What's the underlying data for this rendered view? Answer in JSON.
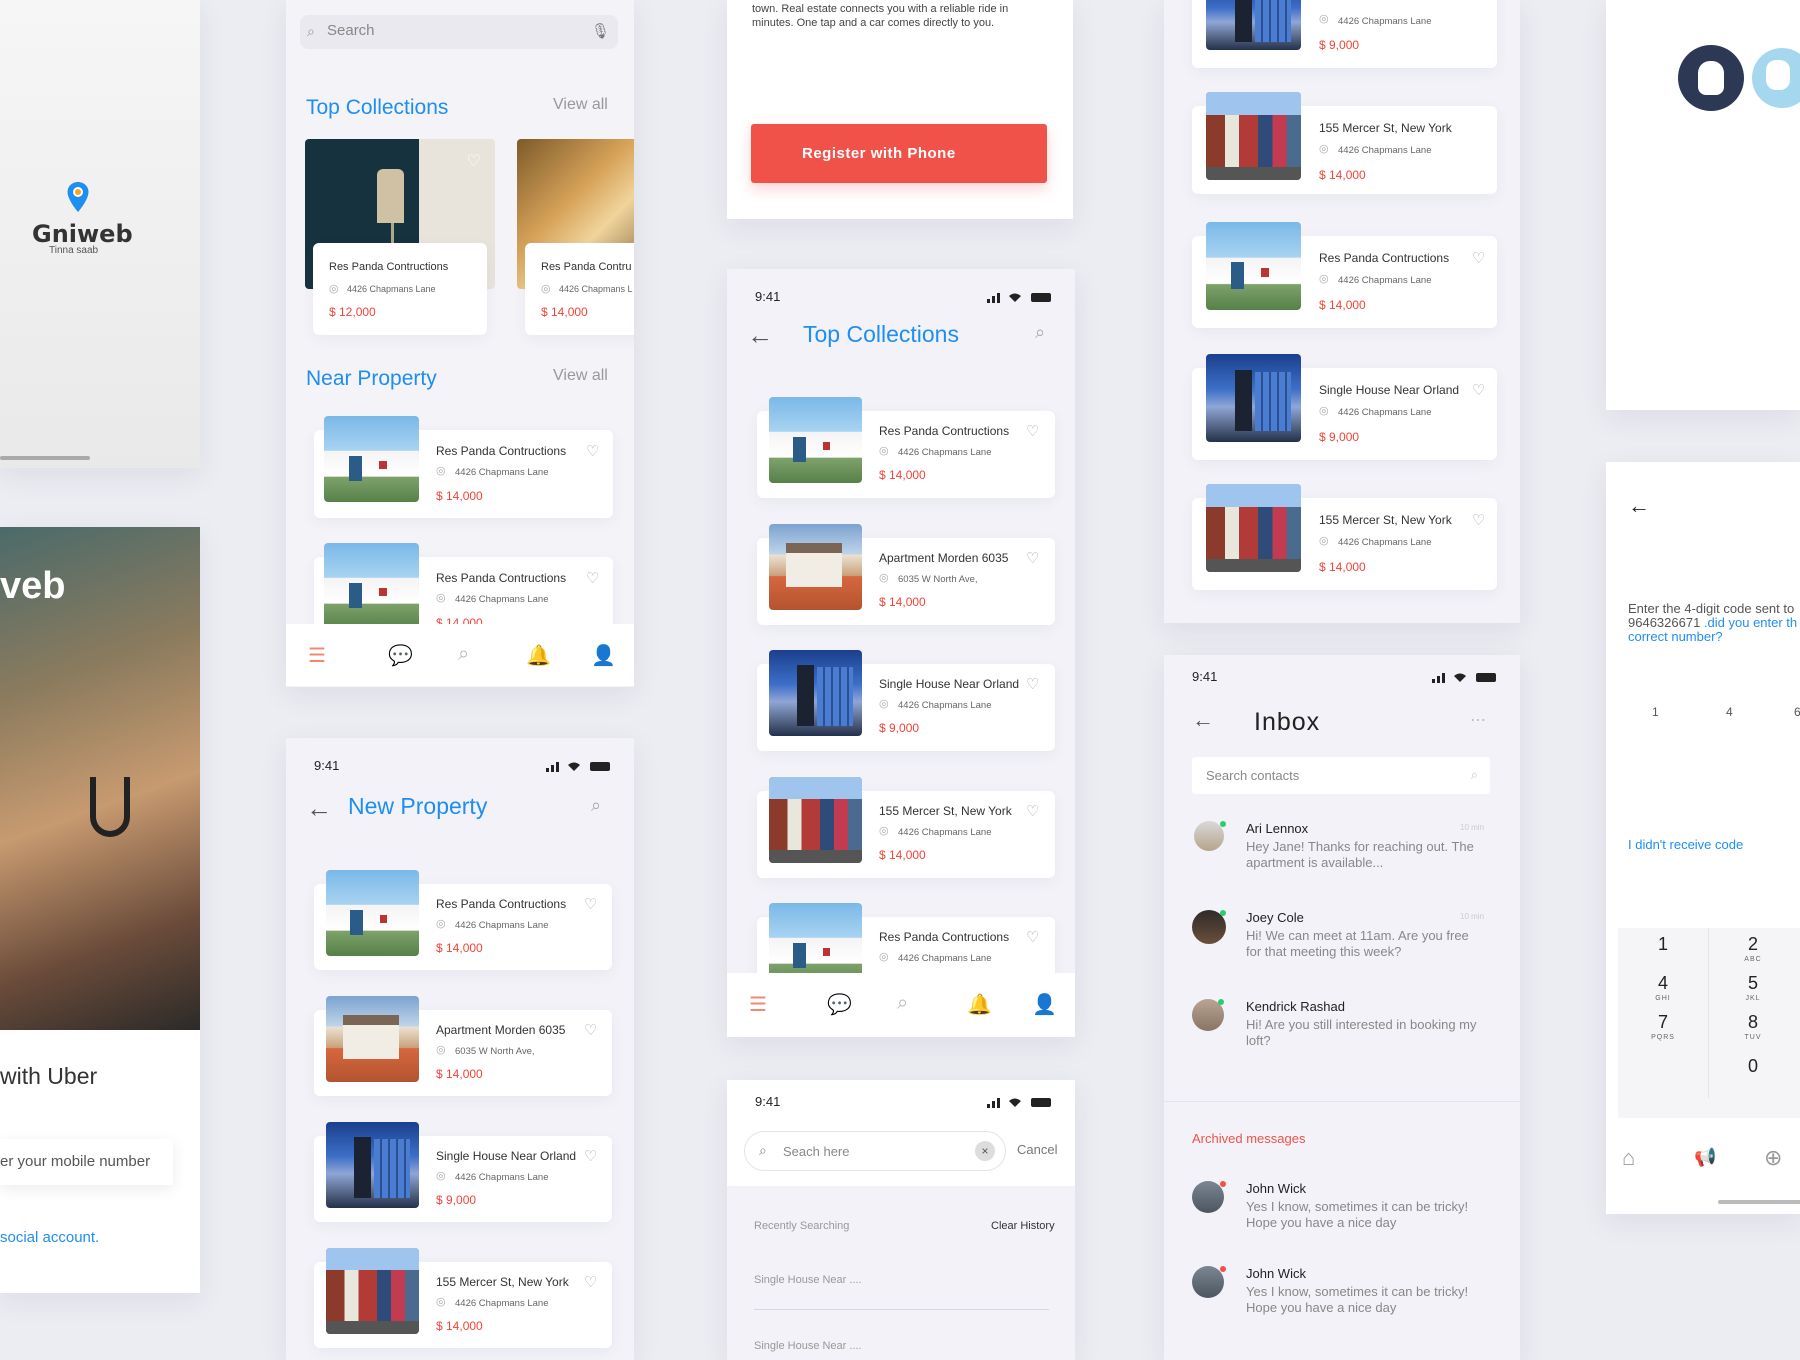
{
  "splash": {
    "brand": "Gniweb",
    "tagline": "Tinna saab"
  },
  "signin": {
    "brand_partial": "veb",
    "connect_partial": "with Uber",
    "mobile_placeholder": "er your mobile number",
    "social_partial": "social account."
  },
  "home": {
    "search_placeholder": "Search",
    "top_collections": "Top Collections",
    "view_all": "View all",
    "collections": [
      {
        "title": "Res Panda Contructions",
        "address": "4426 Chapmans Lane",
        "price": "$ 12,000"
      },
      {
        "title": "Res Panda Contru",
        "address": "4426 Chapmans L",
        "price": "$ 14,000"
      }
    ],
    "near_property": "Near Property",
    "near_view_all": "View all",
    "near": [
      {
        "title": "Res Panda Contructions",
        "address": "4426 Chapmans Lane",
        "price": "$ 14,000"
      },
      {
        "title": "Res Panda Contructions",
        "address": "4426 Chapmans Lane",
        "price": "$ 14,000"
      }
    ]
  },
  "new_property": {
    "time": "9:41",
    "title": "New Property",
    "items": [
      {
        "title": "Res Panda Contructions",
        "address": "4426 Chapmans Lane",
        "price": "$ 14,000"
      },
      {
        "title": "Apartment Morden 6035",
        "address": "6035 W North Ave,",
        "price": "$ 14,000"
      },
      {
        "title": "Single House Near Orland",
        "address": "4426 Chapmans Lane",
        "price": "$ 9,000"
      },
      {
        "title": "155 Mercer St, New York",
        "address": "4426 Chapmans Lane",
        "price": "$ 14,000"
      }
    ]
  },
  "register": {
    "text_line1": "town. Real estate connects you with a reliable ride in",
    "text_line2": "minutes. One tap and a car comes directly to you.",
    "button": "Register with Phone"
  },
  "top_collections_screen": {
    "time": "9:41",
    "title": "Top Collections",
    "items": [
      {
        "title": "Res Panda Contructions",
        "address": "4426 Chapmans Lane",
        "price": "$ 14,000"
      },
      {
        "title": "Apartment Morden 6035",
        "address": "6035 W North Ave,",
        "price": "$ 14,000"
      },
      {
        "title": "Single House Near Orland",
        "address": "4426 Chapmans Lane",
        "price": "$ 9,000"
      },
      {
        "title": "155 Mercer St, New York",
        "address": "4426 Chapmans Lane",
        "price": "$ 14,000"
      },
      {
        "title": "Res Panda Contructions",
        "address": "4426 Chapmans Lane",
        "price": ""
      }
    ]
  },
  "search_screen": {
    "time": "9:41",
    "placeholder": "Seach here",
    "cancel": "Cancel",
    "recently": "Recently Searching",
    "clear": "Clear History",
    "history": [
      "Single House Near ....",
      "Single House Near ...."
    ]
  },
  "list_right": {
    "items": [
      {
        "title": "",
        "address": "4426 Chapmans Lane",
        "price": "$ 9,000"
      },
      {
        "title": "155 Mercer St, New York",
        "address": "4426 Chapmans Lane",
        "price": "$ 14,000"
      },
      {
        "title": "Res Panda Contructions",
        "address": "4426 Chapmans Lane",
        "price": "$ 14,000"
      },
      {
        "title": "Single House Near Orland",
        "address": "4426 Chapmans Lane",
        "price": "$ 9,000"
      },
      {
        "title": "155 Mercer St, New York",
        "address": "4426 Chapmans Lane",
        "price": "$ 14,000"
      }
    ]
  },
  "inbox": {
    "time": "9:41",
    "title": "Inbox",
    "search_placeholder": "Search contacts",
    "messages": [
      {
        "name": "Ari Lennox",
        "text": "Hey Jane! Thanks for reaching out. The apartment is available...",
        "time": "10 min"
      },
      {
        "name": "Joey Cole",
        "text": "Hi! We can meet at 11am. Are you free for that meeting this week?",
        "time": "10 min"
      },
      {
        "name": "Kendrick Rashad",
        "text": "Hi! Are you still interested in booking my loft?",
        "time": ""
      }
    ],
    "archived_label": "Archived messages",
    "archived": [
      {
        "name": "John Wick",
        "text": "Yes I know, sometimes it can be tricky! Hope you have a nice day"
      },
      {
        "name": "John Wick",
        "text": "Yes I know, sometimes it can be tricky! Hope you have a nice day"
      }
    ]
  },
  "verify": {
    "enter_code": "Enter the 4-digit code sent to",
    "phone": "9646326671",
    "wrong_number": " .did you enter th",
    "wrong_number2": "correct number?",
    "code_digits": [
      "1",
      "4",
      "6"
    ],
    "didnt_receive": "I didn't receive code",
    "keys": [
      {
        "n": "1",
        "l": ""
      },
      {
        "n": "2",
        "l": "ABC"
      },
      {
        "n": "4",
        "l": "GHI"
      },
      {
        "n": "5",
        "l": "JKL"
      },
      {
        "n": "7",
        "l": "PQRS"
      },
      {
        "n": "8",
        "l": "TUV"
      },
      {
        "n": "0",
        "l": ""
      }
    ]
  },
  "colors": {
    "accent": "#1f8ef1",
    "price": "#f44336",
    "button": "#f0524a"
  }
}
